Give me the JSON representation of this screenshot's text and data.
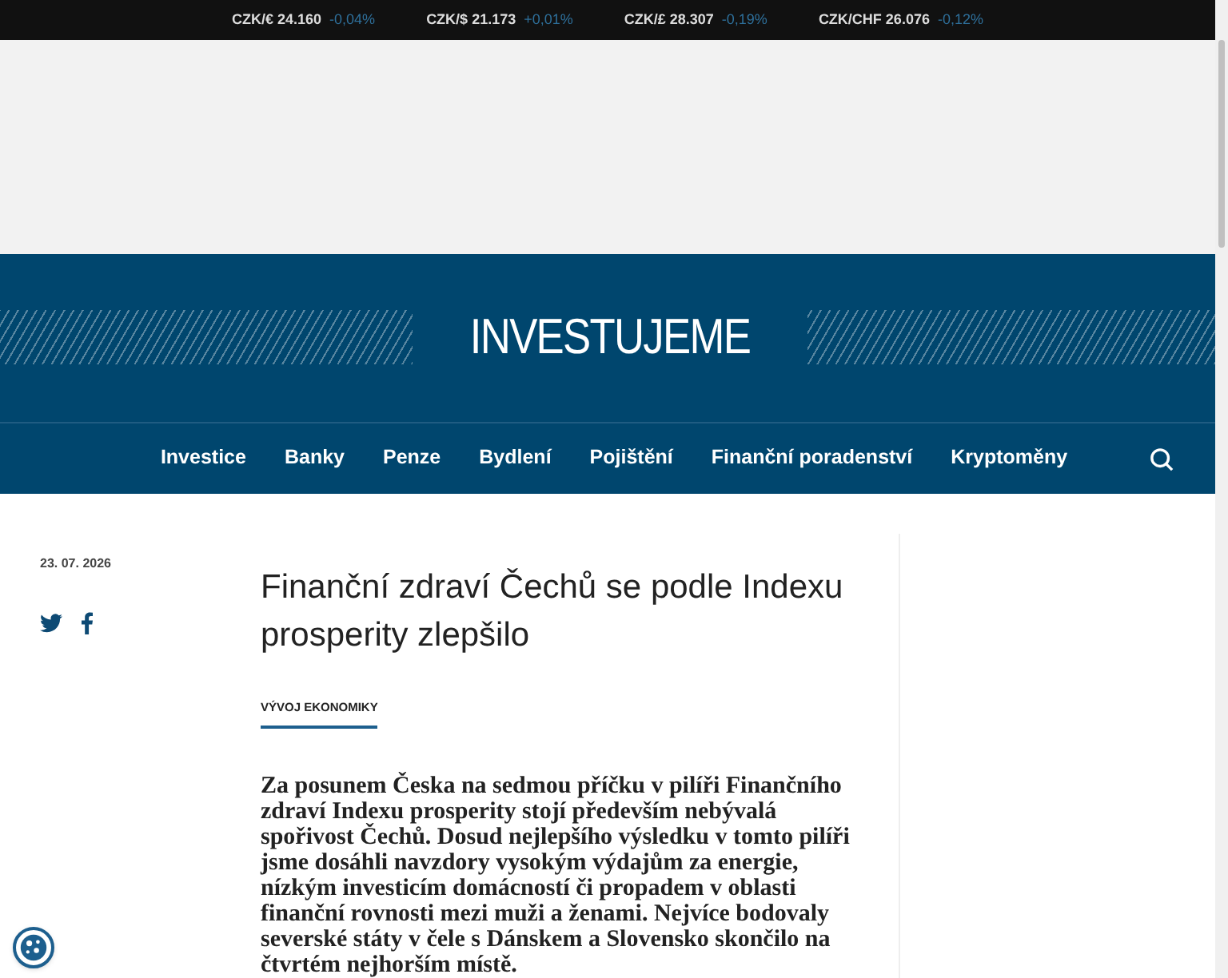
{
  "ticker": [
    {
      "pair": "CZK/€",
      "rate": "24.160",
      "change": "-0,04%"
    },
    {
      "pair": "CZK/$",
      "rate": "21.173",
      "change": "+0,01%"
    },
    {
      "pair": "CZK/£",
      "rate": "28.307",
      "change": "-0,19%"
    },
    {
      "pair": "CZK/CHF",
      "rate": "26.076",
      "change": "-0,12%"
    }
  ],
  "logo": "INVESTUJEME",
  "nav": [
    "Investice",
    "Banky",
    "Penze",
    "Bydlení",
    "Pojištění",
    "Finanční poradenství",
    "Kryptoměny"
  ],
  "article": {
    "date": "23. 07. 2026",
    "title": "Finanční zdraví Čechů se podle Indexu prosperity zlepšilo",
    "category": "VÝVOJ EKONOMIKY",
    "lead": "Za posunem Česka na sedmou příčku v pilíři Finančního zdraví Indexu prosperity stojí především nebývalá spořivost Čechů. Dosud nejlepšího výsledku v tomto pilíři jsme dosáhli navzdory vysokým výdajům za energie, nízkým investicím domácností či propadem v oblasti finanční rovnosti mezi muži a ženami. Nejvíce bodovaly severské státy v čele s Dánskem a Slovensko skončilo na čtvrtém nejhorším místě."
  }
}
